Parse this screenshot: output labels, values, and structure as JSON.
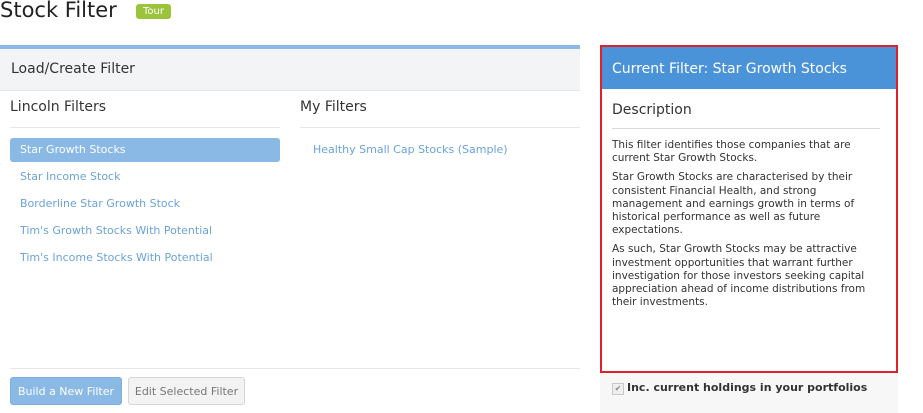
{
  "page": {
    "title": "Stock Filter",
    "tour_label": "Tour"
  },
  "left_panel": {
    "header": "Load/Create Filter",
    "lincoln": {
      "title": "Lincoln Filters",
      "items": [
        "Star Growth Stocks",
        "Star Income Stock",
        "Borderline Star Growth Stock",
        "Tim's Growth Stocks With Potential",
        "Tim's Income Stocks With Potential"
      ],
      "selected_index": 0
    },
    "my_filters": {
      "title": "My Filters",
      "items": [
        "Healthy Small Cap Stocks (Sample)"
      ]
    },
    "buttons": {
      "build": "Build a New Filter",
      "edit": "Edit Selected Filter"
    }
  },
  "right_panel": {
    "header": "Current Filter: Star Growth Stocks",
    "description_title": "Description",
    "paragraphs": [
      "This filter identifies those companies that are current Star Growth Stocks.",
      "Star Growth Stocks are characterised by their consistent Financial Health, and strong management and earnings growth in terms of historical performance as well as future expectations.",
      "As such, Star Growth Stocks may be attractive investment opportunities that warrant further investigation for those investors seeking capital appreciation ahead of income distributions from their investments."
    ]
  },
  "holdings": {
    "label": "Inc. current holdings in your portfolios",
    "checked": true
  },
  "colors": {
    "accent": "#4a93d9",
    "selected": "#8ab9e6",
    "link": "#6aa3d8",
    "highlight_border": "#e0202a",
    "badge": "#9cc33c"
  }
}
